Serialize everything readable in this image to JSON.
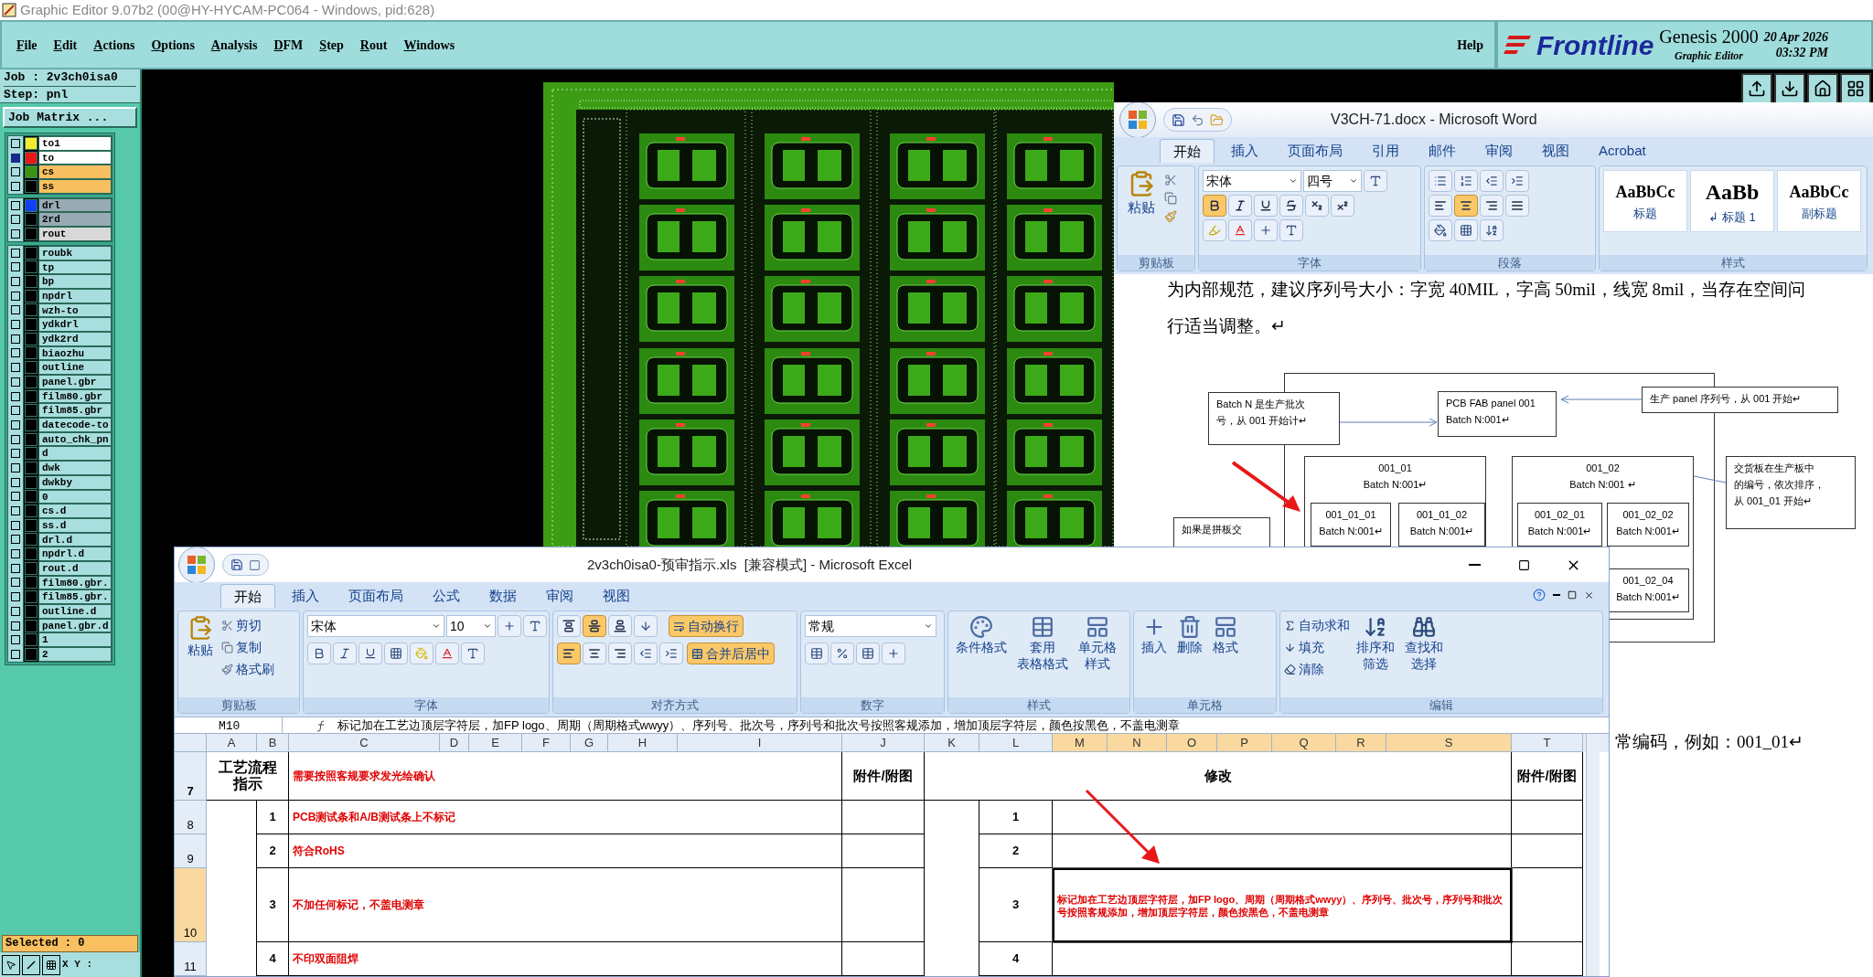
{
  "app": {
    "title": "Graphic Editor 9.07b2 (00@HY-HYCAM-PC064 - Windows, pid:628)",
    "menu": [
      "File",
      "Edit",
      "Actions",
      "Options",
      "Analysis",
      "DFM",
      "Step",
      "Rout",
      "Windows"
    ],
    "help": "Help",
    "brand": {
      "logo": "Frontline",
      "product": "Genesis 2000",
      "subtitle": "Graphic Editor",
      "date": "20 Apr 2026",
      "time": "03:32 PM"
    }
  },
  "job": {
    "job": "Job : 2v3ch0isa0",
    "step": "Step: pnl",
    "matrix_button": "Job Matrix ...",
    "layer_groups": [
      {
        "layers": [
          {
            "name": "to1",
            "color": "#f4ec30",
            "kind": "active",
            "selected": false
          },
          {
            "name": "to",
            "color": "#e81818",
            "kind": "active",
            "selected": true
          },
          {
            "name": "cs",
            "color": "#3c9410",
            "kind": "board",
            "selected": false
          },
          {
            "name": "ss",
            "color": "#000000",
            "kind": "board",
            "selected": false
          }
        ]
      },
      {
        "layers": [
          {
            "name": "drl",
            "color": "#1040f8",
            "kind": "drill",
            "selected": false
          },
          {
            "name": "2rd",
            "color": "#000000",
            "kind": "drill",
            "selected": false
          },
          {
            "name": "rout",
            "color": "#000000",
            "kind": "rout",
            "selected": false
          }
        ]
      },
      {
        "layers": [
          {
            "name": "roubk",
            "color": "#000000",
            "kind": "misc",
            "selected": false
          },
          {
            "name": "tp",
            "color": "#000000",
            "kind": "misc",
            "selected": false
          },
          {
            "name": "bp",
            "color": "#000000",
            "kind": "misc",
            "selected": false
          },
          {
            "name": "npdrl",
            "color": "#000000",
            "kind": "misc",
            "selected": false
          },
          {
            "name": "wzh-to",
            "color": "#000000",
            "kind": "misc",
            "selected": false
          },
          {
            "name": "ydkdrl",
            "color": "#000000",
            "kind": "misc",
            "selected": false
          },
          {
            "name": "ydk2rd",
            "color": "#000000",
            "kind": "misc",
            "selected": false
          },
          {
            "name": "biaozhu",
            "color": "#000000",
            "kind": "misc",
            "selected": false
          },
          {
            "name": "outline",
            "color": "#000000",
            "kind": "misc",
            "selected": false
          },
          {
            "name": "panel.gbr",
            "color": "#000000",
            "kind": "misc",
            "selected": false
          },
          {
            "name": "film80.gbr",
            "color": "#000000",
            "kind": "misc",
            "selected": false
          },
          {
            "name": "film85.gbr",
            "color": "#000000",
            "kind": "misc",
            "selected": false
          },
          {
            "name": "datecode-to",
            "color": "#000000",
            "kind": "misc",
            "selected": false
          },
          {
            "name": "auto_chk_pn",
            "color": "#000000",
            "kind": "misc",
            "selected": false
          },
          {
            "name": "d",
            "color": "#000000",
            "kind": "misc",
            "selected": false
          },
          {
            "name": "dwk",
            "color": "#000000",
            "kind": "misc",
            "selected": false
          },
          {
            "name": "dwkby",
            "color": "#000000",
            "kind": "misc",
            "selected": false
          },
          {
            "name": "0",
            "color": "#000000",
            "kind": "misc",
            "selected": false
          },
          {
            "name": "cs.d",
            "color": "#000000",
            "kind": "misc",
            "selected": false
          },
          {
            "name": "ss.d",
            "color": "#000000",
            "kind": "misc",
            "selected": false
          },
          {
            "name": "drl.d",
            "color": "#000000",
            "kind": "misc",
            "selected": false
          },
          {
            "name": "npdrl.d",
            "color": "#000000",
            "kind": "misc",
            "selected": false
          },
          {
            "name": "rout.d",
            "color": "#000000",
            "kind": "misc",
            "selected": false
          },
          {
            "name": "film80.gbr.",
            "color": "#000000",
            "kind": "misc",
            "selected": false
          },
          {
            "name": "film85.gbr.",
            "color": "#000000",
            "kind": "misc",
            "selected": false
          },
          {
            "name": "outline.d",
            "color": "#000000",
            "kind": "misc",
            "selected": false
          },
          {
            "name": "panel.gbr.d",
            "color": "#000000",
            "kind": "misc",
            "selected": false
          },
          {
            "name": "1",
            "color": "#000000",
            "kind": "misc",
            "selected": false
          },
          {
            "name": "2",
            "color": "#000000",
            "kind": "misc",
            "selected": false
          }
        ]
      }
    ],
    "selected": "Selected : 0",
    "coords": "X Y :"
  },
  "word": {
    "title": "V3CH-71.docx - Microsoft Word",
    "tabs": [
      {
        "label": "开始",
        "selected": true
      },
      {
        "label": "插入",
        "selected": false
      },
      {
        "label": "页面布局",
        "selected": false
      },
      {
        "label": "引用",
        "selected": false
      },
      {
        "label": "邮件",
        "selected": false
      },
      {
        "label": "审阅",
        "selected": false
      },
      {
        "label": "视图",
        "selected": false
      },
      {
        "label": "Acrobat",
        "selected": false
      }
    ],
    "paste": "粘贴",
    "font": "宋体",
    "size": "四号",
    "format_buttons": [
      {
        "kind": "bold",
        "selected": true
      },
      {
        "kind": "italic",
        "selected": false
      },
      {
        "kind": "underline",
        "selected": false
      },
      {
        "kind": "strike",
        "selected": false
      },
      {
        "kind": "subscript",
        "selected": false
      },
      {
        "kind": "superscript",
        "selected": false
      }
    ],
    "align_buttons": [
      {
        "kind": "left",
        "selected": false
      },
      {
        "kind": "center",
        "selected": true
      },
      {
        "kind": "right",
        "selected": false
      },
      {
        "kind": "justify",
        "selected": false
      }
    ],
    "styles": [
      {
        "sample": "AaBbCc",
        "label": "标题"
      },
      {
        "sample": "AaBb",
        "label": "↲ 标题 1"
      },
      {
        "sample": "AaBbCc",
        "label": "副标题"
      }
    ],
    "groups": [
      "剪贴板",
      "字体",
      "段落",
      "样式"
    ],
    "paragraph": [
      "为内部规范，建议序列号大小：字宽 40MIL，字高 50mil，线宽 8mil，当存在空间问",
      "行适当调整。↵"
    ],
    "diagram_boxes": [
      {
        "lines": [
          "Batch  N  是生产批次",
          "号，从 001 开始计↵"
        ]
      },
      {
        "lines": [
          "PCB  FAB  panel  001",
          "Batch N:001↵"
        ]
      },
      {
        "lines": [
          "生产 panel  序列号，从 001 开始↵"
        ]
      },
      {
        "lines": [
          "001_01",
          "Batch N:001↵"
        ]
      },
      {
        "lines": [
          "001_02",
          "Batch N:001 ↵"
        ]
      },
      {
        "lines": [
          "001_01_01",
          "Batch N:001↵"
        ]
      },
      {
        "lines": [
          "001_01_02",
          "Batch N:001↵"
        ]
      },
      {
        "lines": [
          "001_02_01",
          "Batch N:001↵"
        ]
      },
      {
        "lines": [
          "001_02_02",
          "Batch N:001↵"
        ]
      },
      {
        "lines": [
          "001_02_04",
          "Batch N:001↵"
        ]
      },
      {
        "lines": [
          "交货板在生产板中",
          "的编号，依次排序，",
          "从 001_01 开始↵"
        ]
      },
      {
        "lines": [
          "如果是拼板交"
        ]
      }
    ],
    "tail": "常编码，例如：001_01↵"
  },
  "excel": {
    "title": "2v3ch0isa0-预审指示.xls  [兼容模式] - Microsoft Excel",
    "tabs": [
      {
        "label": "开始",
        "selected": true
      },
      {
        "label": "插入",
        "selected": false
      },
      {
        "label": "页面布局",
        "selected": false
      },
      {
        "label": "公式",
        "selected": false
      },
      {
        "label": "数据",
        "selected": false
      },
      {
        "label": "审阅",
        "selected": false
      },
      {
        "label": "视图",
        "selected": false
      }
    ],
    "paste": "粘贴",
    "clipboard_actions": [
      "剪切",
      "复制",
      "格式刷"
    ],
    "font": "宋体",
    "size": "10",
    "valign_buttons": [
      {
        "kind": "top",
        "selected": false
      },
      {
        "kind": "middle",
        "selected": true
      },
      {
        "kind": "bottom",
        "selected": false
      }
    ],
    "halign_buttons": [
      {
        "kind": "left",
        "selected": true
      },
      {
        "kind": "center",
        "selected": false
      },
      {
        "kind": "right",
        "selected": false
      }
    ],
    "wrap": {
      "label": "自动换行",
      "selected": true
    },
    "merge": {
      "label": "合并后居中",
      "selected": true
    },
    "number_format": "常规",
    "style_buttons": [
      {
        "lines": [
          "条件格式"
        ]
      },
      {
        "lines": [
          "套用",
          "表格格式"
        ]
      },
      {
        "lines": [
          "单元格",
          "样式"
        ]
      }
    ],
    "cell_buttons": [
      "插入",
      "删除",
      "格式"
    ],
    "edit_actions": [
      "自动求和",
      "填充",
      "清除"
    ],
    "edit_buttons": [
      {
        "lines": [
          "排序和",
          "筛选"
        ]
      },
      {
        "lines": [
          "查找和",
          "选择"
        ]
      }
    ],
    "groups": [
      "剪贴板",
      "字体",
      "对齐方式",
      "数字",
      "样式",
      "单元格",
      "编辑"
    ],
    "name_box": "M10",
    "formula": "标记加在工艺边顶层字符层，加FP logo、周期（周期格式wwyy）、序列号、批次号，序列号和批次号按照客规添加，增加顶层字符层，颜色按黑色，不盖电测章",
    "columns": [
      {
        "label": "A",
        "selected": false
      },
      {
        "label": "B",
        "selected": false
      },
      {
        "label": "C",
        "selected": false
      },
      {
        "label": "D",
        "selected": false
      },
      {
        "label": "E",
        "selected": false
      },
      {
        "label": "F",
        "selected": false
      },
      {
        "label": "G",
        "selected": false
      },
      {
        "label": "H",
        "selected": false
      },
      {
        "label": "I",
        "selected": false
      },
      {
        "label": "J",
        "selected": false
      },
      {
        "label": "K",
        "selected": false
      },
      {
        "label": "L",
        "selected": false
      },
      {
        "label": "M",
        "selected": true
      },
      {
        "label": "N",
        "selected": true
      },
      {
        "label": "O",
        "selected": true
      },
      {
        "label": "P",
        "selected": true
      },
      {
        "label": "Q",
        "selected": true
      },
      {
        "label": "R",
        "selected": true
      },
      {
        "label": "S",
        "selected": true
      },
      {
        "label": "T",
        "selected": false
      }
    ],
    "rows": [
      {
        "kind": "header",
        "label": "7",
        "selected": false,
        "process": [
          "工艺流程",
          "指示"
        ],
        "instruction": "需要按照客规要求发光绘确认",
        "attachment": "附件/附图",
        "change": "修改",
        "attachment_2": "附件/附图"
      },
      {
        "kind": "item",
        "label": "8",
        "selected": false,
        "no": "1",
        "instruction": "PCB测试条和A/B测试条上不标记",
        "no_2": "1",
        "change_selected": false
      },
      {
        "kind": "item",
        "label": "9",
        "selected": false,
        "no": "2",
        "instruction": "符合RoHS",
        "no_2": "2",
        "change_selected": false
      },
      {
        "kind": "item",
        "label": "10",
        "selected": true,
        "no": "3",
        "instruction": "不加任何标记，不盖电测章",
        "no_2": "3",
        "change": "标记加在工艺边顶层字符层，加FP  logo、周期（周期格式wwyy）、序列号、批次号，序列号和批次号按照客规添加，增加顶层字符层，颜色按黑色，不盖电测章",
        "change_selected": true
      },
      {
        "kind": "item",
        "label": "11",
        "selected": false,
        "no": "4",
        "instruction": "不印双面阻焊",
        "no_2": "4",
        "change_selected": false
      }
    ]
  }
}
